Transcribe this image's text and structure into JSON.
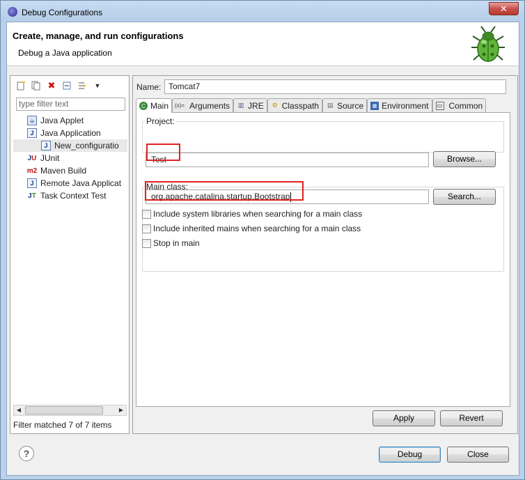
{
  "window": {
    "title": "Debug Configurations",
    "close_glyph": "✕"
  },
  "header": {
    "title": "Create, manage, and run configurations",
    "subtitle": "Debug a Java application"
  },
  "left": {
    "filter_placeholder": "type filter text",
    "tree": [
      {
        "label": "Java Applet",
        "icon": "java-applet-icon"
      },
      {
        "label": "Java Application",
        "icon": "java-application-icon"
      },
      {
        "label": "New_configuratio",
        "icon": "java-config-icon",
        "child": true
      },
      {
        "label": "JUnit",
        "icon": "junit-icon"
      },
      {
        "label": "Maven Build",
        "icon": "maven-icon"
      },
      {
        "label": "Remote Java Applicat",
        "icon": "remote-java-icon"
      },
      {
        "label": "Task Context Test",
        "icon": "task-context-icon"
      }
    ],
    "filter_status": "Filter matched 7 of 7 items"
  },
  "right": {
    "name_label": "Name:",
    "name_value": "Tomcat7",
    "tabs": [
      {
        "label": "Main",
        "icon": "main-tab-icon"
      },
      {
        "label": "Arguments",
        "icon": "arguments-icon"
      },
      {
        "label": "JRE",
        "icon": "jre-icon"
      },
      {
        "label": "Classpath",
        "icon": "classpath-icon"
      },
      {
        "label": "Source",
        "icon": "source-icon"
      },
      {
        "label": "Environment",
        "icon": "environment-icon"
      },
      {
        "label": "Common",
        "icon": "common-icon"
      }
    ],
    "project_label": "Project:",
    "project_value": "Test",
    "browse_label": "Browse...",
    "main_class_label": "Main class:",
    "main_class_value": "org.apache.catalina.startup.Bootstrap",
    "search_label": "Search...",
    "checkboxes": [
      {
        "label": "Include system libraries when searching for a main class",
        "checked": false
      },
      {
        "label": "Include inherited mains when searching for a main class",
        "checked": false
      },
      {
        "label": "Stop in main",
        "checked": false
      }
    ],
    "apply_label": "Apply",
    "revert_label": "Revert"
  },
  "footer": {
    "debug_label": "Debug",
    "close_label": "Close",
    "help_glyph": "?"
  },
  "colors": {
    "highlight": "#e02020",
    "titlebar": "#b9d1ea"
  }
}
